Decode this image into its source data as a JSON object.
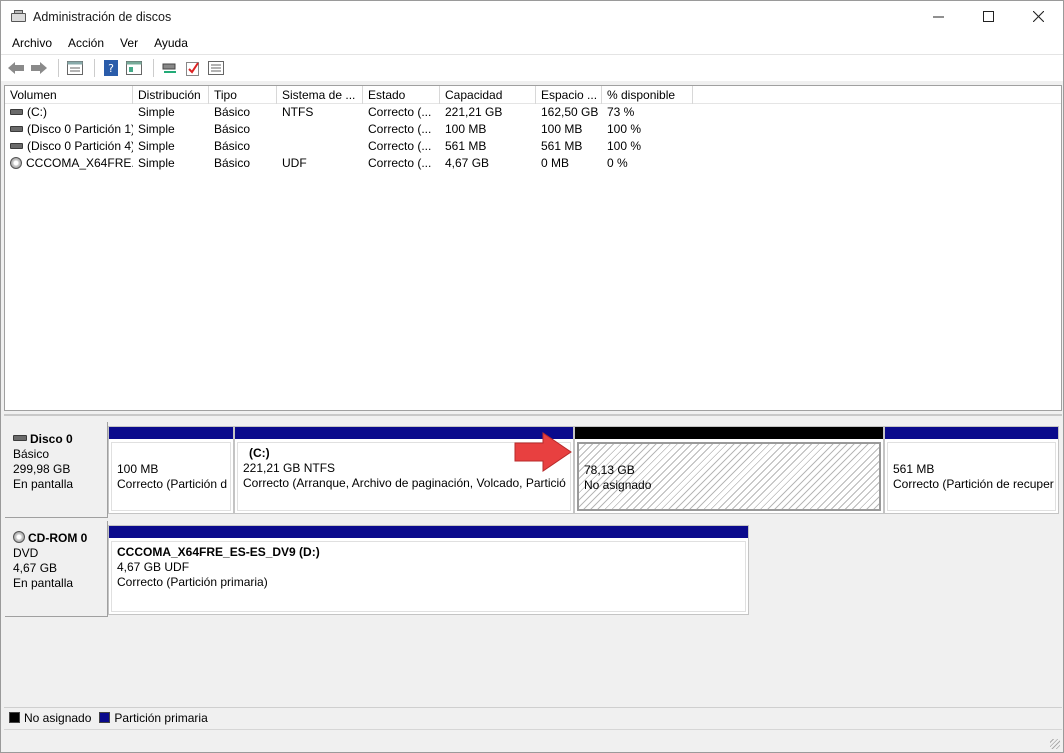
{
  "window": {
    "title": "Administración de discos",
    "min_icon": "minimize-icon",
    "max_icon": "maximize-icon",
    "close_icon": "close-icon"
  },
  "menu": [
    "Archivo",
    "Acción",
    "Ver",
    "Ayuda"
  ],
  "toolbar": [
    "back-icon",
    "forward-icon",
    "list-view-icon",
    "help-icon",
    "properties-icon",
    "connect-icon",
    "check-icon",
    "settings-list-icon"
  ],
  "volumes": {
    "headers": [
      "Volumen",
      "Distribución",
      "Tipo",
      "Sistema de ...",
      "Estado",
      "Capacidad",
      "Espacio ...",
      "% disponible"
    ],
    "rows": [
      {
        "icon": "hdd",
        "cells": [
          "(C:)",
          "Simple",
          "Básico",
          "NTFS",
          "Correcto (...",
          "221,21 GB",
          "162,50 GB",
          "73 %"
        ]
      },
      {
        "icon": "hdd",
        "cells": [
          "(Disco 0 Partición 1)",
          "Simple",
          "Básico",
          "",
          "Correcto (...",
          "100 MB",
          "100 MB",
          "100 %"
        ]
      },
      {
        "icon": "hdd",
        "cells": [
          "(Disco 0 Partición 4)",
          "Simple",
          "Básico",
          "",
          "Correcto (...",
          "561 MB",
          "561 MB",
          "100 %"
        ]
      },
      {
        "icon": "cd",
        "cells": [
          "CCCOMA_X64FRE...",
          "Simple",
          "Básico",
          "UDF",
          "Correcto (...",
          "4,67 GB",
          "0 MB",
          "0 %"
        ]
      }
    ]
  },
  "disks": {
    "disk0": {
      "title": "Disco 0",
      "type": "Básico",
      "size": "299,98 GB",
      "status": "En pantalla",
      "partitions": [
        {
          "name": "",
          "size": "100 MB",
          "status": "Correcto (Partición d"
        },
        {
          "name": "(C:)",
          "size": "221,21 GB NTFS",
          "status": "Correcto (Arranque, Archivo de paginación, Volcado, Partició"
        },
        {
          "name": "",
          "size": "78,13 GB",
          "status": "No asignado"
        },
        {
          "name": "",
          "size": "561 MB",
          "status": "Correcto (Partición de recuper"
        }
      ]
    },
    "cdrom0": {
      "title": "CD-ROM 0",
      "type": "DVD",
      "size": "4,67 GB",
      "status": "En pantalla",
      "partition": {
        "name": "CCCOMA_X64FRE_ES-ES_DV9  (D:)",
        "size": "4,67 GB UDF",
        "status": "Correcto (Partición primaria)"
      }
    }
  },
  "legend": {
    "unallocated": "No asignado",
    "primary": "Partición primaria"
  },
  "colors": {
    "primary": "#0a0a8c",
    "unallocated": "#000000",
    "arrow": "#e84040"
  }
}
